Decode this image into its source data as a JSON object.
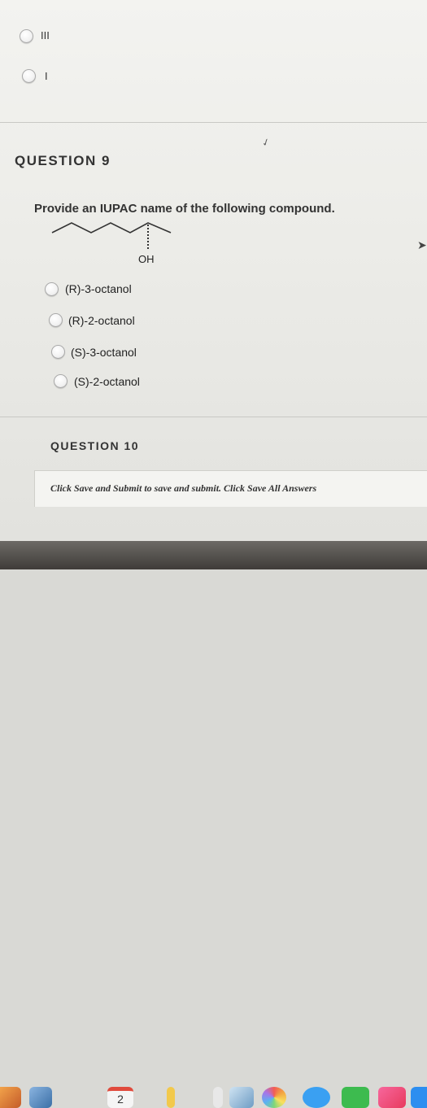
{
  "previous_question": {
    "options": [
      {
        "label": "III"
      },
      {
        "label": "I"
      }
    ]
  },
  "question9": {
    "title": "QUESTION 9",
    "prompt": "Provide an IUPAC name of the following compound.",
    "molecule_label": "OH",
    "options": [
      {
        "label": "(R)-3-octanol"
      },
      {
        "label": "(R)-2-octanol"
      },
      {
        "label": "(S)-3-octanol"
      },
      {
        "label": "(S)-2-octanol"
      }
    ]
  },
  "question10": {
    "title": "QUESTION 10"
  },
  "footer": {
    "save_text": "Click Save and Submit to save and submit. Click Save All Answers"
  },
  "dock": {
    "calendar_day": "2",
    "icons": [
      "finder-icon",
      "calendar-icon",
      "notes-icon",
      "stickies-icon",
      "preview-icon",
      "photos-icon",
      "messages-icon",
      "facetime-icon",
      "music-icon",
      "app-store-icon"
    ]
  }
}
